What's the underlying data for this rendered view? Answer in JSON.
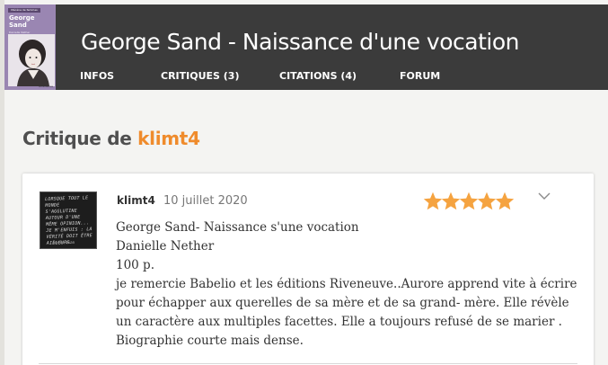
{
  "header": {
    "book_title": "George Sand - Naissance d'une vocation",
    "cover": {
      "series": "Mécène de femmes",
      "title_line1": "George",
      "title_line2": "Sand",
      "author": "Danielle Nether",
      "publisher": "Riveneuve"
    },
    "nav": [
      {
        "label": "INFOS"
      },
      {
        "label": "CRITIQUES (3)"
      },
      {
        "label": "CITATIONS (4)"
      },
      {
        "label": "FORUM"
      }
    ]
  },
  "main": {
    "heading_prefix": "Critique de",
    "heading_user": "klimt4"
  },
  "review": {
    "avatar_quote": "Lorsque tout le monde s'agglutine autour d'une même opinion... je m'enfuis : la vérité doit être ailleurs.",
    "avatar_sig": "Boris Vian",
    "author": "klimt4",
    "date": "10 juillet 2020",
    "rating": 5,
    "rating_max": 5,
    "lines": [
      "George Sand- Naissance s'une vocation",
      "Danielle Nether",
      "100 p.",
      "je remercie Babelio et les éditions Riveneuve..Aurore apprend vite à écrire",
      "pour échapper aux querelles de sa mère et de sa grand- mère. Elle révèle",
      "un caractère aux multiples facettes. Elle a toujours refusé de se marier .",
      "Biographie courte mais dense."
    ]
  },
  "colors": {
    "header_bg": "#3b3b3b",
    "accent": "#ef8b2c",
    "star": "#f5a340",
    "page_bg": "#f4f4f2"
  },
  "icons": {
    "rating": "star-icon",
    "expand": "chevron-down-icon"
  }
}
